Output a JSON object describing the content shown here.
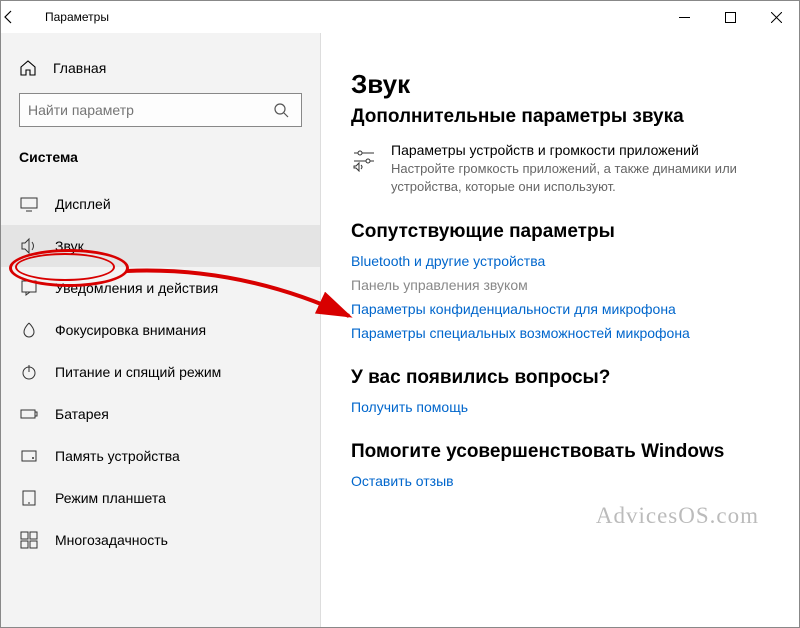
{
  "window": {
    "title": "Параметры"
  },
  "sidebar": {
    "home": "Главная",
    "search_placeholder": "Найти параметр",
    "section": "Система",
    "items": [
      {
        "label": "Дисплей"
      },
      {
        "label": "Звук"
      },
      {
        "label": "Уведомления и действия"
      },
      {
        "label": "Фокусировка внимания"
      },
      {
        "label": "Питание и спящий режим"
      },
      {
        "label": "Батарея"
      },
      {
        "label": "Память устройства"
      },
      {
        "label": "Режим планшета"
      },
      {
        "label": "Многозадачность"
      }
    ]
  },
  "main": {
    "heading": "Звук",
    "sub1": "Дополнительные параметры звука",
    "device": {
      "title": "Параметры устройств и громкости приложений",
      "desc": "Настройте громкость приложений, а также динамики или устройства, которые они используют."
    },
    "sub2": "Сопутствующие параметры",
    "links": {
      "bluetooth": "Bluetooth и другие устройства",
      "panel": "Панель управления звуком",
      "privacy": "Параметры конфиденциальности для микрофона",
      "ease": "Параметры специальных возможностей микрофона"
    },
    "help_heading": "У вас появились вопросы?",
    "help_link": "Получить помощь",
    "improve_heading": "Помогите усовершенствовать Windows",
    "improve_link": "Оставить отзыв"
  },
  "watermark": "AdvicesOS.com"
}
